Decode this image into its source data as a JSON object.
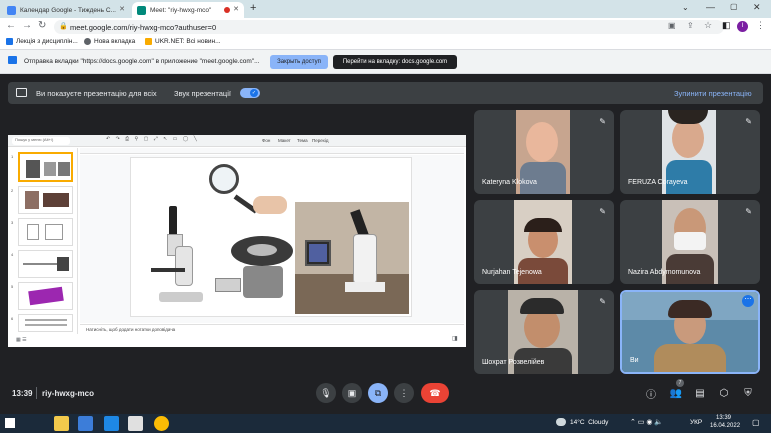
{
  "browser": {
    "tabs": [
      {
        "title": "Календар Google - Тиждень С...",
        "active": false
      },
      {
        "title": "Meet: \"riy-hwxg-mco\"",
        "active": true
      }
    ],
    "new_tab_label": "+",
    "url": "meet.google.com/riy-hwxg-mco?authuser=0",
    "bookmarks": [
      "Лекція з дисциплін...",
      "Нова вкладка",
      "UKR.NET: Всі новин..."
    ]
  },
  "infobar": {
    "message": "Отправка вкладки \"https://docs.google.com\" в приложение \"meet.google.com\"...",
    "stop_label": "Закрыть доступ",
    "switch_label": "Перейти на вкладку: docs.google.com"
  },
  "presenting_bar": {
    "text": "Ви показуєте презентацію для всіх",
    "audio_label": "Звук презентації",
    "audio_on": true,
    "stop_label": "Зупинити презентацію"
  },
  "slides": {
    "search_placeholder": "Пошук у меню (Alt+/)",
    "menu": [
      "Фон",
      "Макет",
      "Тема",
      "Перехід"
    ],
    "notes_placeholder": "Натисніть, щоб додати нотатки доповідача",
    "thumb_numbers": [
      "1",
      "2",
      "3",
      "4",
      "5",
      "6"
    ]
  },
  "participants": [
    {
      "name": "Kateryna Klokova"
    },
    {
      "name": "FERUZA Corayeva"
    },
    {
      "name": "Nurjahan Tejenowa"
    },
    {
      "name": "Nazira Abdymomunova"
    },
    {
      "name": "Шохрат Розвелійев"
    },
    {
      "name": "Ви"
    }
  ],
  "bottombar": {
    "time": "13:39",
    "meeting_code": "riy-hwxg-mco",
    "people_count": "7"
  },
  "taskbar": {
    "weather": "14°C  Cloudy",
    "lang": "УКР",
    "clock_time": "13:39",
    "clock_date": "16.04.2022"
  },
  "colors": {
    "meet_bg": "#202124",
    "tile_bg": "#3c4043",
    "accent_blue": "#8ab4f8",
    "end_call_red": "#ea4335",
    "active_speaker_border": "#8ab4f8"
  }
}
